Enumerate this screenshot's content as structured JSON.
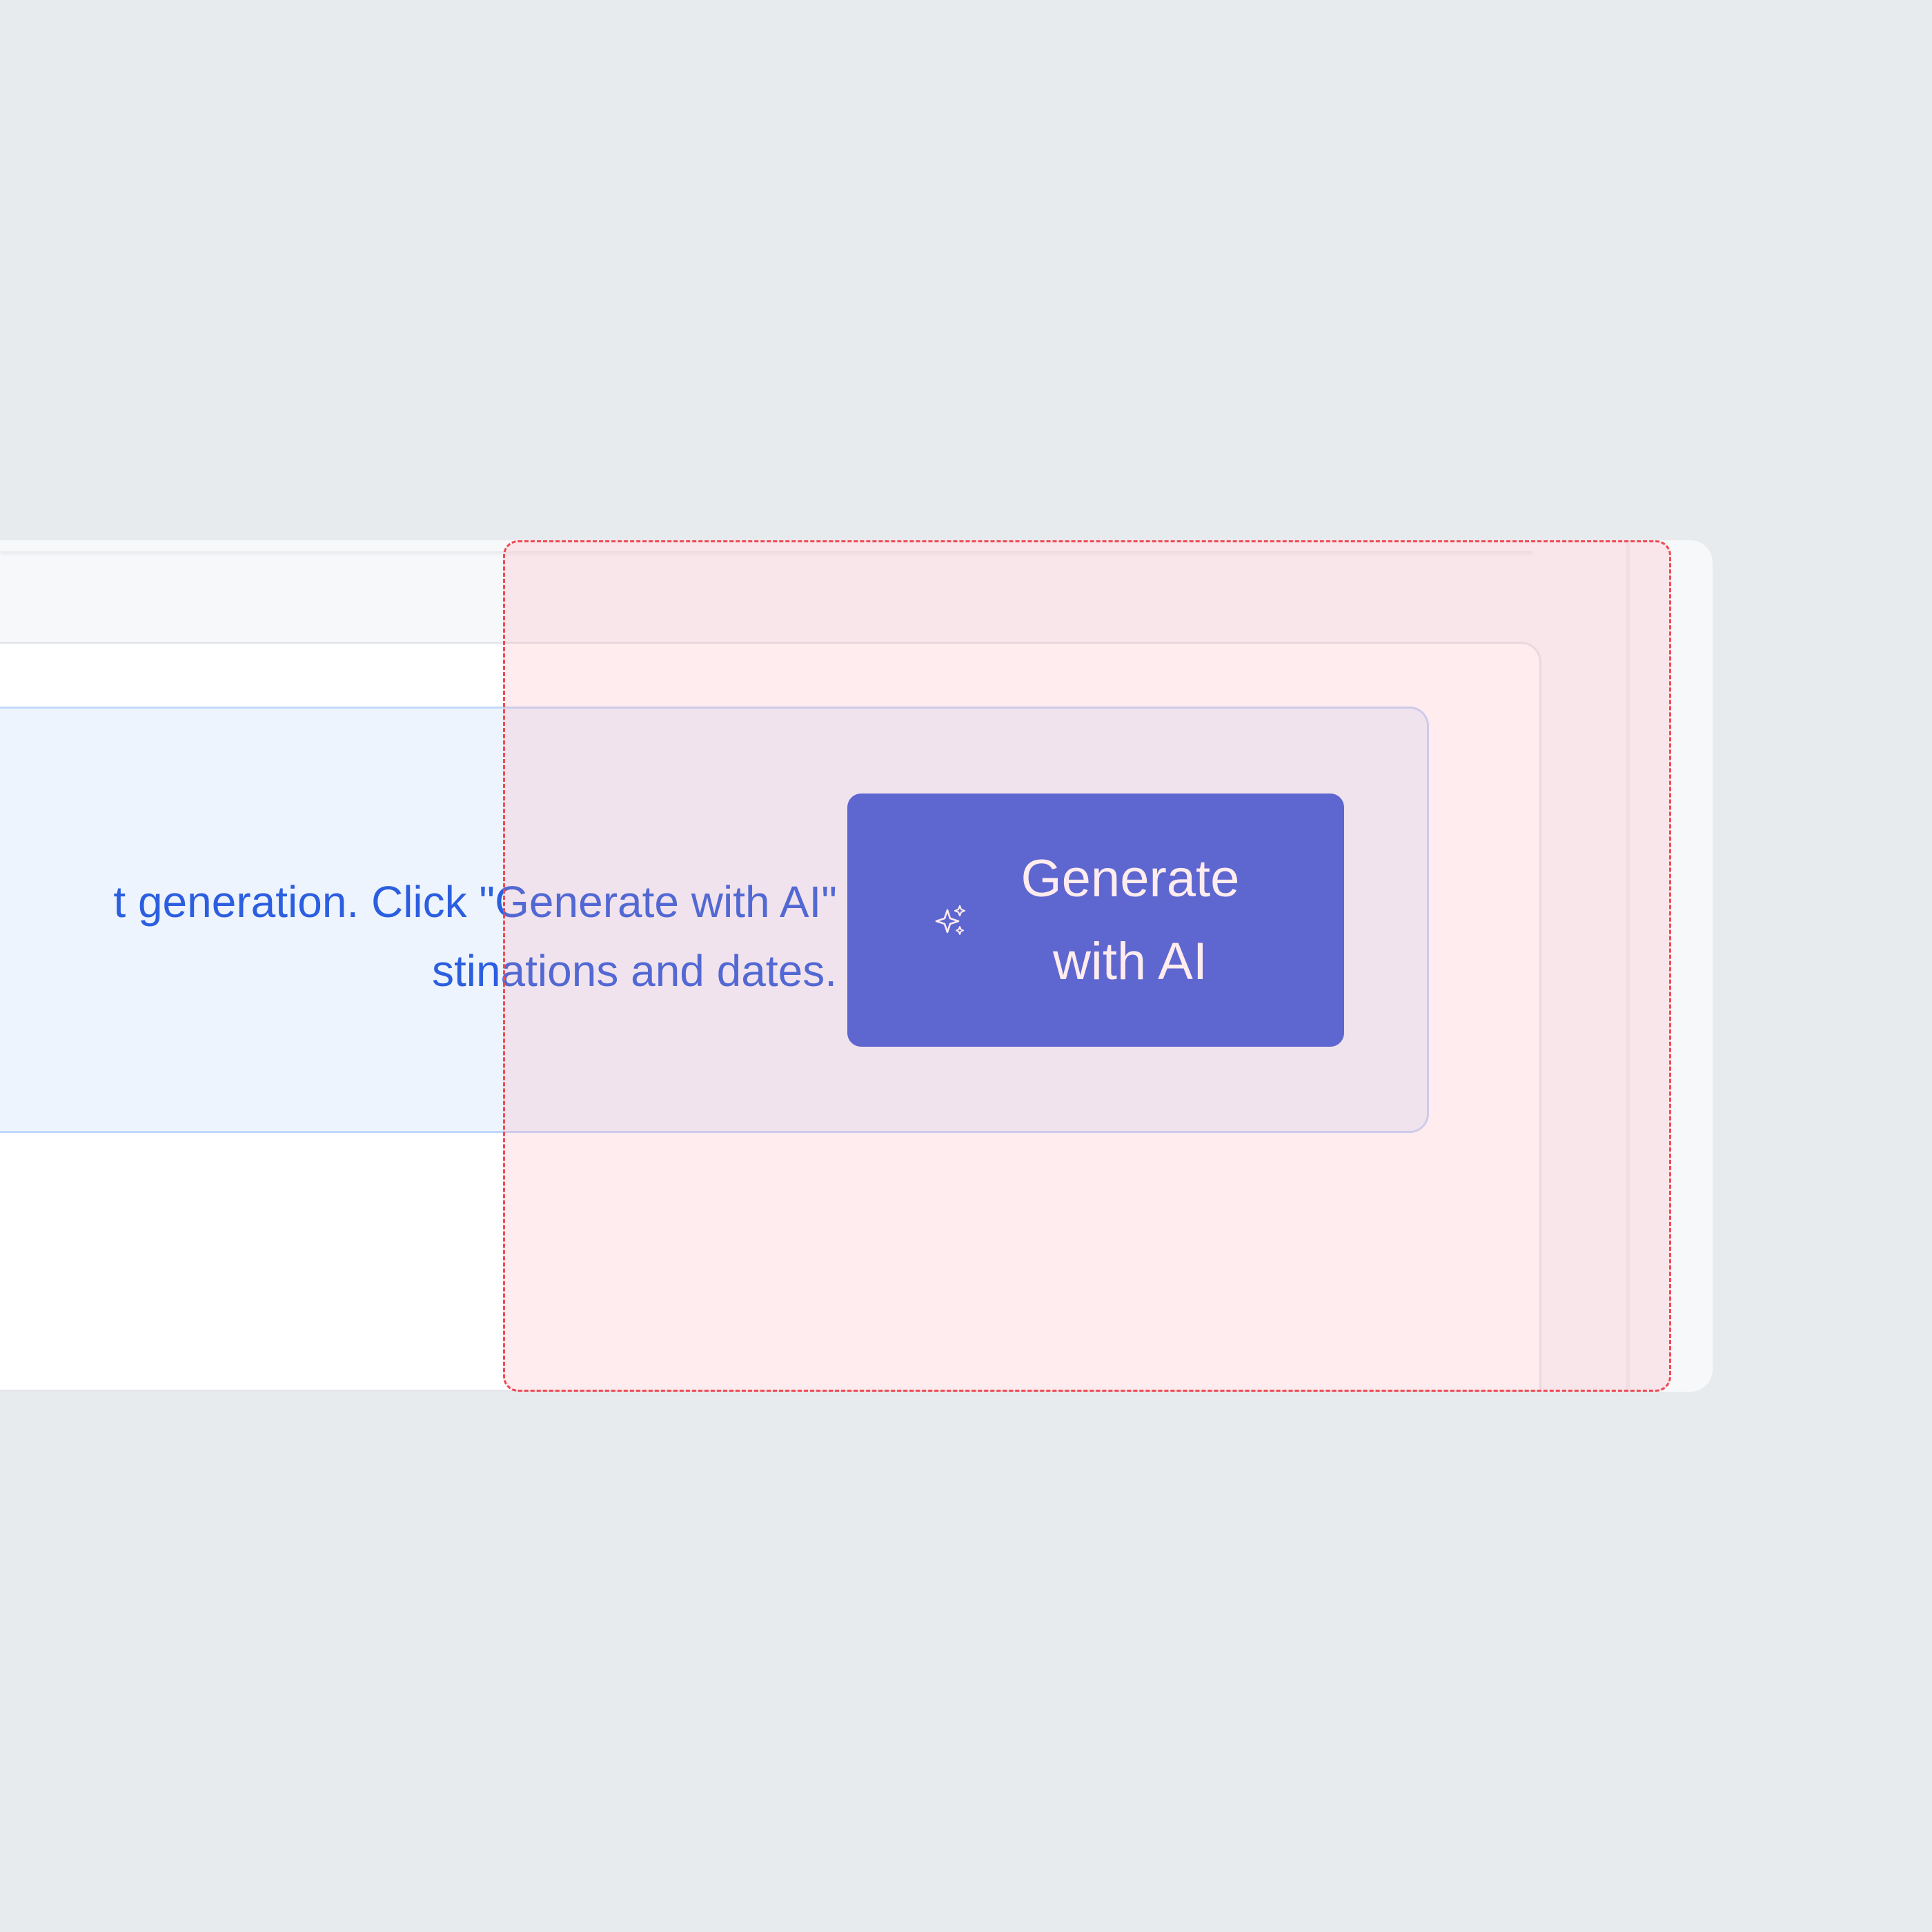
{
  "banner": {
    "line1": "t generation. Click \"Generate with AI\"",
    "line2": "stinations and dates."
  },
  "generate_button": {
    "line1": "Generate",
    "line2": "with AI",
    "icon": "sparkle-icon"
  },
  "colors": {
    "page_bg": "#e7ebee",
    "banner_bg": "#eef4fe",
    "banner_text": "#2c5fdf",
    "button_bg": "#3b5ddb",
    "overlay_border": "#ee4a55"
  }
}
